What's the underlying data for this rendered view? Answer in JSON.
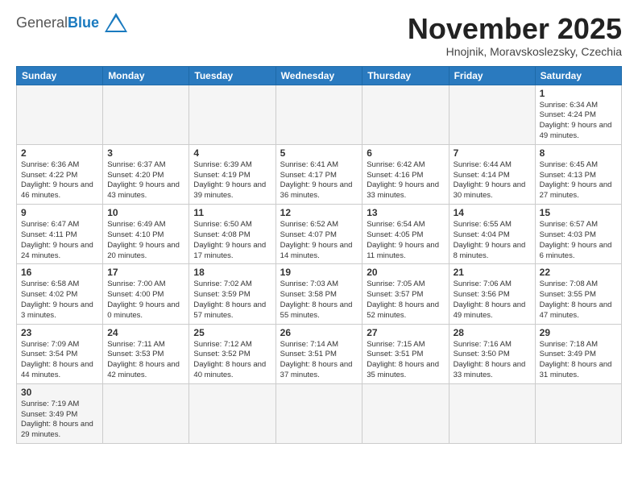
{
  "header": {
    "logo_general": "General",
    "logo_blue": "Blue",
    "month_title": "November 2025",
    "subtitle": "Hnojnik, Moravskoslezsky, Czechia"
  },
  "days_of_week": [
    "Sunday",
    "Monday",
    "Tuesday",
    "Wednesday",
    "Thursday",
    "Friday",
    "Saturday"
  ],
  "weeks": [
    [
      {
        "day": "",
        "info": ""
      },
      {
        "day": "",
        "info": ""
      },
      {
        "day": "",
        "info": ""
      },
      {
        "day": "",
        "info": ""
      },
      {
        "day": "",
        "info": ""
      },
      {
        "day": "",
        "info": ""
      },
      {
        "day": "1",
        "info": "Sunrise: 6:34 AM\nSunset: 4:24 PM\nDaylight: 9 hours and 49 minutes."
      }
    ],
    [
      {
        "day": "2",
        "info": "Sunrise: 6:36 AM\nSunset: 4:22 PM\nDaylight: 9 hours and 46 minutes."
      },
      {
        "day": "3",
        "info": "Sunrise: 6:37 AM\nSunset: 4:20 PM\nDaylight: 9 hours and 43 minutes."
      },
      {
        "day": "4",
        "info": "Sunrise: 6:39 AM\nSunset: 4:19 PM\nDaylight: 9 hours and 39 minutes."
      },
      {
        "day": "5",
        "info": "Sunrise: 6:41 AM\nSunset: 4:17 PM\nDaylight: 9 hours and 36 minutes."
      },
      {
        "day": "6",
        "info": "Sunrise: 6:42 AM\nSunset: 4:16 PM\nDaylight: 9 hours and 33 minutes."
      },
      {
        "day": "7",
        "info": "Sunrise: 6:44 AM\nSunset: 4:14 PM\nDaylight: 9 hours and 30 minutes."
      },
      {
        "day": "8",
        "info": "Sunrise: 6:45 AM\nSunset: 4:13 PM\nDaylight: 9 hours and 27 minutes."
      }
    ],
    [
      {
        "day": "9",
        "info": "Sunrise: 6:47 AM\nSunset: 4:11 PM\nDaylight: 9 hours and 24 minutes."
      },
      {
        "day": "10",
        "info": "Sunrise: 6:49 AM\nSunset: 4:10 PM\nDaylight: 9 hours and 20 minutes."
      },
      {
        "day": "11",
        "info": "Sunrise: 6:50 AM\nSunset: 4:08 PM\nDaylight: 9 hours and 17 minutes."
      },
      {
        "day": "12",
        "info": "Sunrise: 6:52 AM\nSunset: 4:07 PM\nDaylight: 9 hours and 14 minutes."
      },
      {
        "day": "13",
        "info": "Sunrise: 6:54 AM\nSunset: 4:05 PM\nDaylight: 9 hours and 11 minutes."
      },
      {
        "day": "14",
        "info": "Sunrise: 6:55 AM\nSunset: 4:04 PM\nDaylight: 9 hours and 8 minutes."
      },
      {
        "day": "15",
        "info": "Sunrise: 6:57 AM\nSunset: 4:03 PM\nDaylight: 9 hours and 6 minutes."
      }
    ],
    [
      {
        "day": "16",
        "info": "Sunrise: 6:58 AM\nSunset: 4:02 PM\nDaylight: 9 hours and 3 minutes."
      },
      {
        "day": "17",
        "info": "Sunrise: 7:00 AM\nSunset: 4:00 PM\nDaylight: 9 hours and 0 minutes."
      },
      {
        "day": "18",
        "info": "Sunrise: 7:02 AM\nSunset: 3:59 PM\nDaylight: 8 hours and 57 minutes."
      },
      {
        "day": "19",
        "info": "Sunrise: 7:03 AM\nSunset: 3:58 PM\nDaylight: 8 hours and 55 minutes."
      },
      {
        "day": "20",
        "info": "Sunrise: 7:05 AM\nSunset: 3:57 PM\nDaylight: 8 hours and 52 minutes."
      },
      {
        "day": "21",
        "info": "Sunrise: 7:06 AM\nSunset: 3:56 PM\nDaylight: 8 hours and 49 minutes."
      },
      {
        "day": "22",
        "info": "Sunrise: 7:08 AM\nSunset: 3:55 PM\nDaylight: 8 hours and 47 minutes."
      }
    ],
    [
      {
        "day": "23",
        "info": "Sunrise: 7:09 AM\nSunset: 3:54 PM\nDaylight: 8 hours and 44 minutes."
      },
      {
        "day": "24",
        "info": "Sunrise: 7:11 AM\nSunset: 3:53 PM\nDaylight: 8 hours and 42 minutes."
      },
      {
        "day": "25",
        "info": "Sunrise: 7:12 AM\nSunset: 3:52 PM\nDaylight: 8 hours and 40 minutes."
      },
      {
        "day": "26",
        "info": "Sunrise: 7:14 AM\nSunset: 3:51 PM\nDaylight: 8 hours and 37 minutes."
      },
      {
        "day": "27",
        "info": "Sunrise: 7:15 AM\nSunset: 3:51 PM\nDaylight: 8 hours and 35 minutes."
      },
      {
        "day": "28",
        "info": "Sunrise: 7:16 AM\nSunset: 3:50 PM\nDaylight: 8 hours and 33 minutes."
      },
      {
        "day": "29",
        "info": "Sunrise: 7:18 AM\nSunset: 3:49 PM\nDaylight: 8 hours and 31 minutes."
      }
    ],
    [
      {
        "day": "30",
        "info": "Sunrise: 7:19 AM\nSunset: 3:49 PM\nDaylight: 8 hours and 29 minutes."
      },
      {
        "day": "",
        "info": ""
      },
      {
        "day": "",
        "info": ""
      },
      {
        "day": "",
        "info": ""
      },
      {
        "day": "",
        "info": ""
      },
      {
        "day": "",
        "info": ""
      },
      {
        "day": "",
        "info": ""
      }
    ]
  ]
}
